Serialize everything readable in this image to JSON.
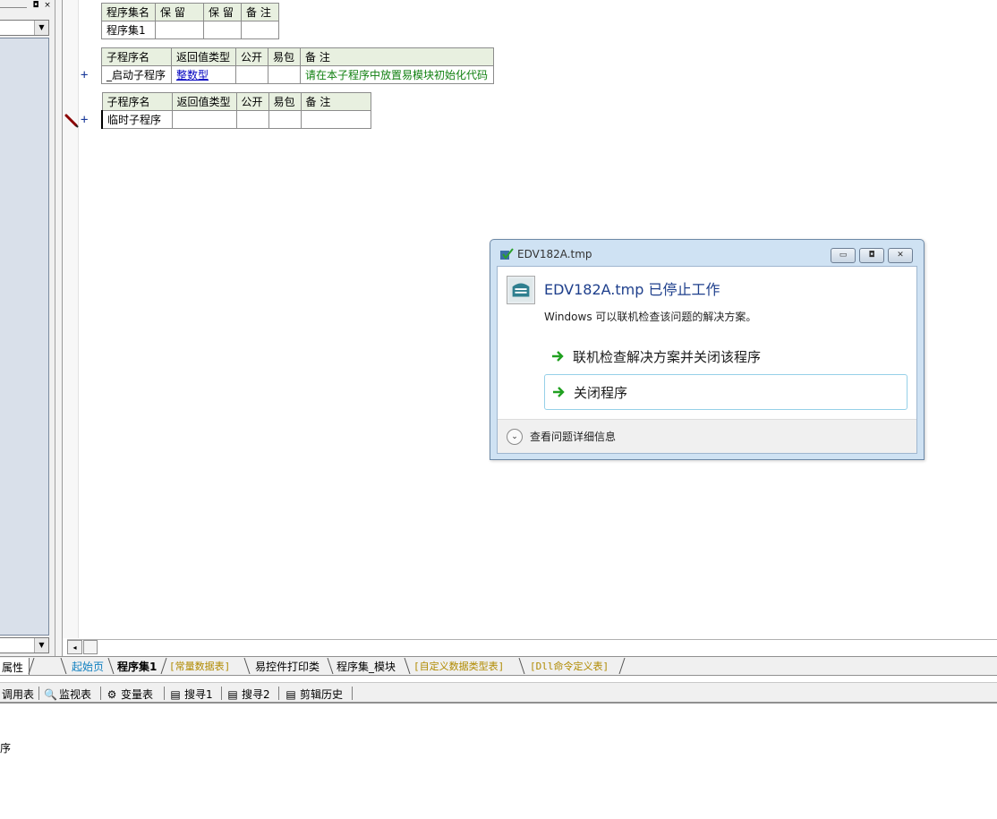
{
  "left_panel": {
    "restore_glyph": "◘",
    "close_glyph": "×",
    "dropdown_glyph": "▼",
    "bottom_dropdown_glyph": "▼"
  },
  "tables": {
    "assembly": {
      "headers": [
        "程序集名",
        "保 留",
        "保 留",
        "备 注"
      ],
      "row": [
        "程序集1",
        "",
        "",
        ""
      ]
    },
    "sub1": {
      "headers": [
        "子程序名",
        "返回值类型",
        "公开",
        "易包",
        "备 注"
      ],
      "row": {
        "name": "_启动子程序",
        "return_type": "整数型",
        "public": "",
        "epkg": "",
        "remark": "请在本子程序中放置易模块初始化代码"
      }
    },
    "sub2": {
      "headers": [
        "子程序名",
        "返回值类型",
        "公开",
        "易包",
        "备 注"
      ],
      "row": {
        "name": "临时子程序",
        "return_type": "",
        "public": "",
        "epkg": "",
        "remark": ""
      }
    },
    "expand_glyph": "+"
  },
  "scrollbar": {
    "left_glyph": "◂"
  },
  "tabs": {
    "properties": "属性",
    "items": [
      {
        "label": "起始页",
        "style": "blue"
      },
      {
        "label": "程序集1",
        "style": "bold"
      },
      {
        "label": "[常量数据表]",
        "style": "olive"
      },
      {
        "label": "易控件打印类",
        "style": "normal"
      },
      {
        "label": "程序集_模块",
        "style": "normal"
      },
      {
        "label": "[自定义数据类型表]",
        "style": "olive"
      },
      {
        "label": "[Dll命令定义表]",
        "style": "olive"
      }
    ]
  },
  "toolbar": {
    "items": [
      {
        "label": "调用表",
        "icon": ""
      },
      {
        "label": "监视表",
        "icon": "🔍"
      },
      {
        "label": "变量表",
        "icon": "⚙"
      },
      {
        "label": "搜寻1",
        "icon": "▤"
      },
      {
        "label": "搜寻2",
        "icon": "▤"
      },
      {
        "label": "剪辑历史",
        "icon": "▤"
      }
    ]
  },
  "output": {
    "text": "序"
  },
  "dialog": {
    "title": "EDV182A.tmp",
    "heading": "EDV182A.tmp 已停止工作",
    "subtitle": "Windows 可以联机检查该问题的解决方案。",
    "option1": "联机检查解决方案并关闭该程序",
    "option2": "关闭程序",
    "details": "查看问题详细信息",
    "minimize_glyph": "▭",
    "maximize_glyph": "◘",
    "close_glyph": "✕",
    "chevron_glyph": "⌄",
    "accent_color": "#1e3f8c",
    "arrow_color": "#20a020"
  }
}
